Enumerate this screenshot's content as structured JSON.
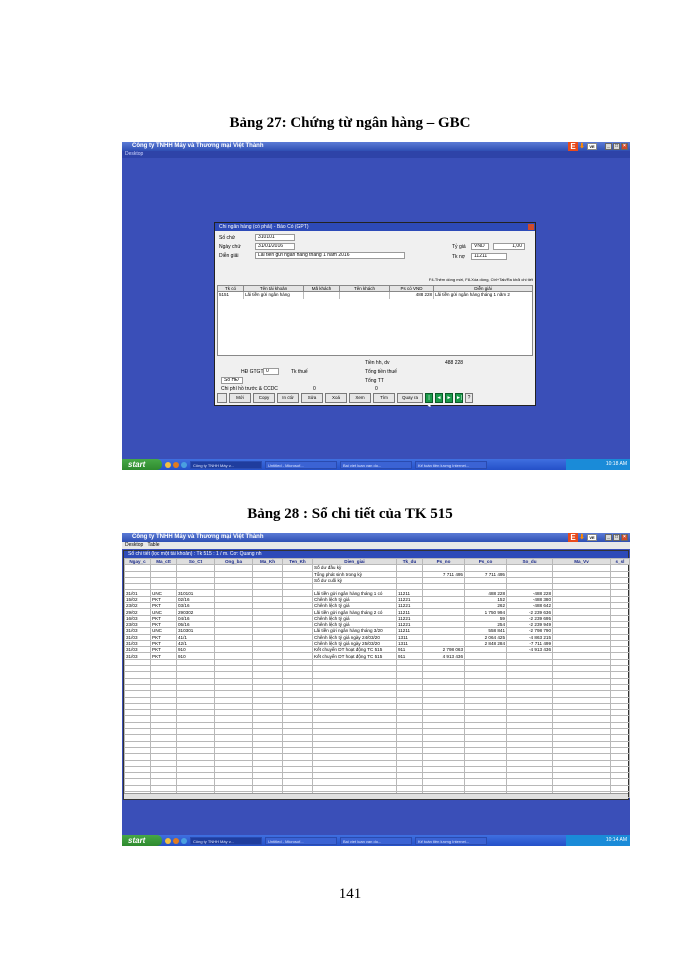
{
  "captions": {
    "fig1": "Bảng 27: Chứng từ ngân hàng – GBC",
    "fig2": "Bảng 28 : Sổ chi tiết của TK 515",
    "page_number": "141"
  },
  "app": {
    "title": "Công ty TNHH Máy và Thương mại Việt Thành",
    "menu1": "Desktop",
    "menu2": "Table",
    "logo_letter": "E",
    "lang_badge": "VE"
  },
  "taskbar": {
    "start": "start",
    "tasks": [
      "Công ty TNHH Máy v...",
      "Untitled - Microsof...",
      "Bai viet luan van do...",
      "Kế toán tiền lương Internet..."
    ],
    "time1": "10:18 AM",
    "time2": "10:14 AM"
  },
  "voucher": {
    "title": "Chi ngân hàng (có phải) - Báo Có (GPT)",
    "labels": {
      "so_ct": "Số chứ",
      "ngay_ct": "Ngày chứ",
      "dien_giai": "Diễn giải",
      "ty_gia": "Tỷ giá",
      "tk_no": "Tk nợ",
      "tien_hang": "Tiền hh, dv",
      "thue": "Tổng tiền thuế",
      "tong_tt": "Tổng TT",
      "hd_gtgt": "HĐ GTGT",
      "tk_thue": "Tk thuế",
      "so_hd": "Sổ HĐ",
      "chi_phi": "Chi phí hồ trước & CCDC"
    },
    "values": {
      "so_ct": "310101",
      "ngay_ct": "31/01/2016",
      "dien_giai": "Lãi tiền gửi ngân hàng tháng 1 năm 2016",
      "currency": "VND",
      "rate": "1,00",
      "tk_no": "11211",
      "tien_hang": "488 228",
      "hd_gtgt": "0",
      "chi_phi": "0",
      "tong_tt_value": "0"
    },
    "hint": "F4-Thêm dòng mới, F8-Xóa dòng, Ctrl+Tab/Ra khỏi chi tiết",
    "grid_headers": [
      "Tk có",
      "Tên tài khoản",
      "Mã khách",
      "Tên khách",
      "Ps có VND",
      "Diễn giải"
    ],
    "grid_rows": [
      [
        "5151",
        "Lãi tiền gửi ngân hàng",
        "",
        "",
        "488 228",
        "Lãi tiền gửi ngân hàng tháng 1 năm 2"
      ]
    ],
    "buttons": [
      "Mới",
      "Copy",
      "In ctừ",
      "Sửa",
      "Xoá",
      "Xem",
      "Tìm",
      "Quay ra"
    ],
    "nav": [
      "|◄",
      "◄",
      "►",
      "►|",
      "?"
    ]
  },
  "ledger": {
    "title": "Sổ chi tiết (lọc một tài khoản) : Tk 515 : 1 / m. Cơ: Quang nh",
    "headers": [
      "Ngay_c",
      "Ma_ctt",
      "So_Ct",
      "Ong_ba",
      "Ma_Kh",
      "Ten_Kh",
      "Dien_giai",
      "Tk_du",
      "Ps_no",
      "Ps_co",
      "So_du",
      "Ma_Vv",
      "s_sl"
    ],
    "rows": [
      [
        "",
        "",
        "",
        "",
        "",
        "",
        "Số dư đầu kỳ",
        "",
        "",
        "",
        "",
        "",
        ""
      ],
      [
        "",
        "",
        "",
        "",
        "",
        "",
        "Tổng phát sinh trong kỳ",
        "",
        "7 711 495",
        "7 711 495",
        "",
        "",
        ""
      ],
      [
        "",
        "",
        "",
        "",
        "",
        "",
        "Số dư cuối kỳ",
        "",
        "",
        "",
        "",
        "",
        ""
      ],
      [
        "",
        "",
        "",
        "",
        "",
        "",
        "",
        "",
        "",
        "",
        "",
        "",
        ""
      ],
      [
        "31/01",
        "UNC",
        "310101",
        "",
        "",
        "",
        "Lãi tiền gửi ngân hàng tháng 1 có",
        "11211",
        "",
        "488 228",
        "-488 228",
        "",
        ""
      ],
      [
        "15/02",
        "PKT",
        "02/16",
        "",
        "",
        "",
        "Chênh lệch tỷ giá",
        "11221",
        "",
        "152",
        "-488 380",
        "",
        ""
      ],
      [
        "23/02",
        "PKT",
        "03/16",
        "",
        "",
        "",
        "Chênh lệch tỷ giá",
        "11221",
        "",
        "262",
        "-488 642",
        "",
        ""
      ],
      [
        "29/02",
        "UNC",
        "290302",
        "",
        "",
        "",
        "Lãi tiền gửi ngân hàng tháng 2 có",
        "11211",
        "",
        "1 750 994",
        "-2 239 636",
        "",
        ""
      ],
      [
        "16/03",
        "PKT",
        "04/16",
        "",
        "",
        "",
        "Chênh lệch tỷ giá",
        "11221",
        "",
        "59",
        "-2 239 695",
        "",
        ""
      ],
      [
        "23/03",
        "PKT",
        "05/16",
        "",
        "",
        "",
        "Chênh lệch tỷ giá",
        "11221",
        "",
        "254",
        "-2 239 949",
        "",
        ""
      ],
      [
        "31/03",
        "UNC",
        "310301",
        "",
        "",
        "",
        "Lãi tiền gửi ngân hàng tháng 3/20",
        "11211",
        "",
        "558 841",
        "-2 798 790",
        "",
        ""
      ],
      [
        "31/03",
        "PKT",
        "41/1",
        "",
        "",
        "",
        "Chênh lệch tỷ giá ngày 24/03/20",
        "1311",
        "",
        "2 064 425",
        "-4 863 215",
        "",
        ""
      ],
      [
        "31/03",
        "PKT",
        "42/1",
        "",
        "",
        "",
        "Chênh lệch tỷ giá ngày 25/03/20",
        "1311",
        "",
        "2 848 284",
        "-7 711 499",
        "",
        ""
      ],
      [
        "31/03",
        "PKT",
        "910",
        "",
        "",
        "",
        "Kết chuyển DT hoạt động TC 515",
        "911",
        "2 798 063",
        "",
        "-4 913 436",
        "",
        ""
      ],
      [
        "31/03",
        "PKT",
        "910",
        "",
        "",
        "",
        "Kết chuyển DT hoạt động TC 515",
        "911",
        "4 913 436",
        "",
        "",
        "",
        ""
      ]
    ],
    "empty_rows": 22
  }
}
